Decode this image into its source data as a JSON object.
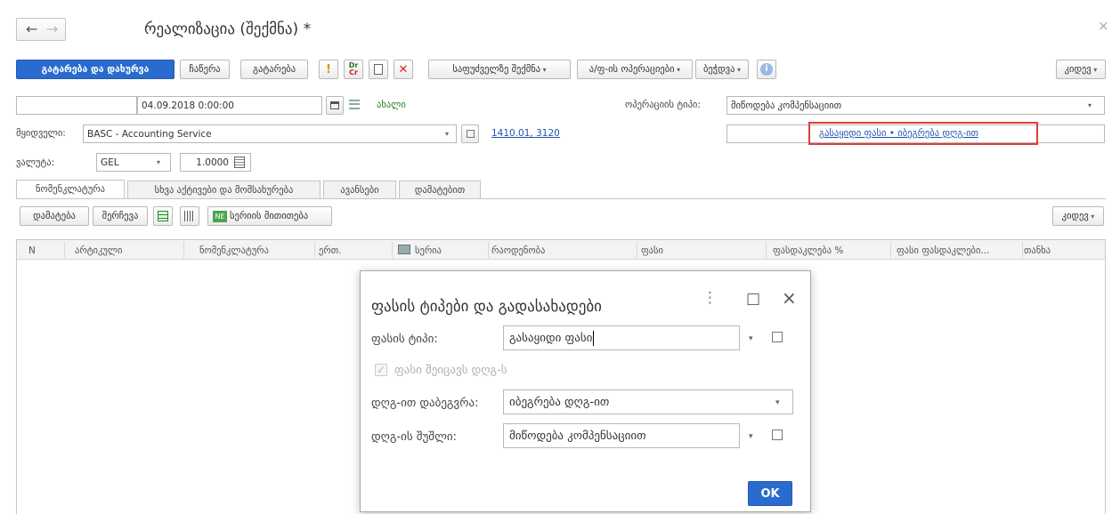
{
  "window": {
    "title": "რეალიზაცია (შექმნა) *",
    "close_glyph": "×",
    "back_glyph": "←",
    "forward_glyph": "→"
  },
  "toolbar": {
    "post_close_label": "გატარება და დახურვა",
    "save_label": "ჩაწერა",
    "post_label": "გატარება",
    "dr_label": "Dr",
    "cr_label": "Cr",
    "create_on_basis_label": "საფუძველზე შექმნა",
    "invoice_ops_label": "ა/ფ-ის ოპერაციები",
    "print_label": "ბეჭდვა",
    "more_label": "კიდევ"
  },
  "header": {
    "date_value": "04.09.2018  0:00:00",
    "status_label": "ახალი",
    "operation_type_label": "ოპერაციის ტიპი:",
    "operation_type_value": "მიწოდება კომპენსაციით",
    "customer_label": "მყიდველი:",
    "customer_value": "BASC - Accounting Service",
    "accounts_link": "1410.01, 3120",
    "price_link": "გასაყიდი ფასი • იბეგრება დღგ-ით",
    "currency_label": "ვალუტა:",
    "currency_value": "GEL",
    "rate_value": "1.0000"
  },
  "tabs": [
    {
      "label": "ნომენკლატურა"
    },
    {
      "label": "სხვა აქტივები და მომსახურება"
    },
    {
      "label": "ავანსები"
    },
    {
      "label": "დამატებით"
    }
  ],
  "grid_toolbar": {
    "add_label": "დამატება",
    "select_label": "შერჩევა",
    "serial_label": "სერიის მითითება",
    "serial_icon_text": "NE",
    "more_label": "კიდევ"
  },
  "table": {
    "columns": [
      "N",
      "არტიკული",
      "ნომენკლატურა",
      "ერთ.",
      "სერია",
      "რაოდენობა",
      "ფასი",
      "ფასდაკლება %",
      "ფასი ფასდაკლები...",
      "თანხა"
    ]
  },
  "dialog": {
    "title": "ფასის ტიპები და გადასახადები",
    "price_type_label": "ფასის ტიპი:",
    "price_type_value": "გასაყიდი ფასი",
    "vat_included_label": "ფასი შეიცავს დღგ-ს",
    "vat_taxation_label": "დღგ-ით დაბეგვრა:",
    "vat_taxation_value": "იბეგრება დღგ-ით",
    "vat_rate_label": "დღგ-ის შუშლი:",
    "vat_rate_value": "მიწოდება კომპენსაციით",
    "ok_label": "OK",
    "menu_glyph": "⋮",
    "maximize_glyph": "□",
    "close_glyph": "×"
  },
  "colors": {
    "accent": "#2a6bd0",
    "link": "#1e56b0",
    "highlight_border": "#d9403a"
  }
}
